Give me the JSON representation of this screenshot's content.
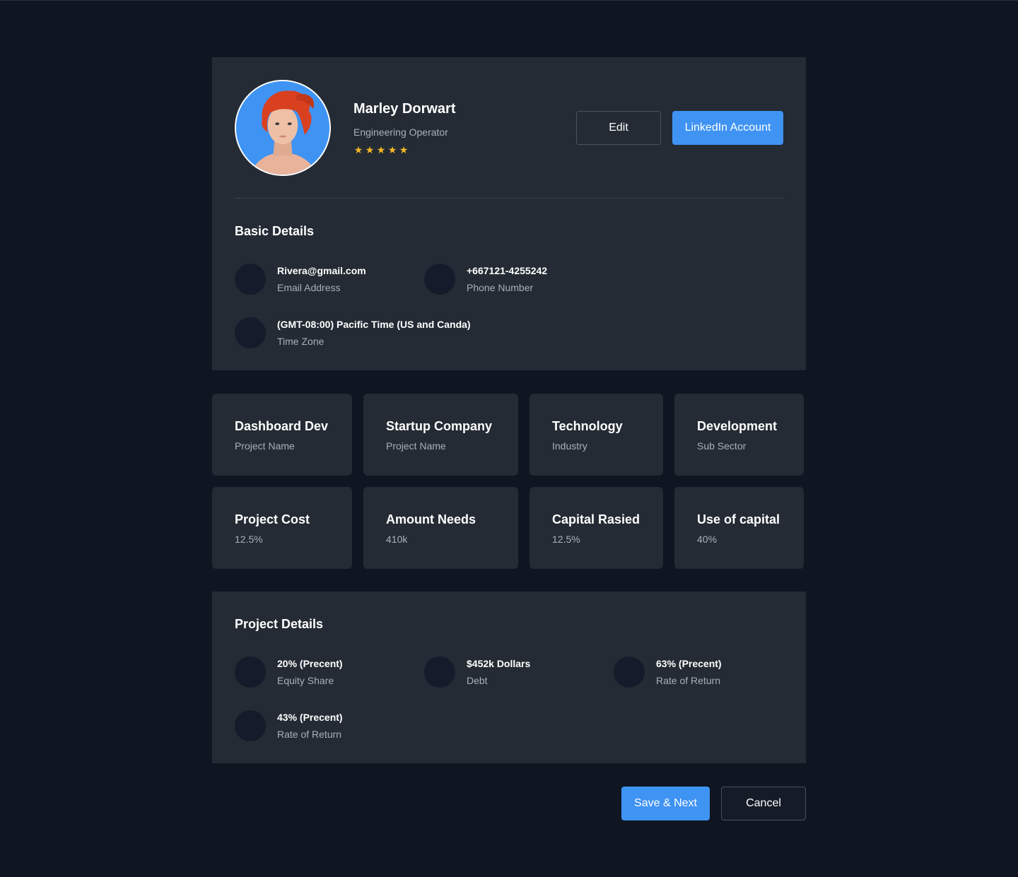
{
  "profile": {
    "name": "Marley Dorwart",
    "role": "Engineering Operator",
    "rating": 5,
    "edit_label": "Edit",
    "linkedin_label": "LinkedIn Account"
  },
  "basic_details": {
    "title": "Basic Details",
    "items": [
      {
        "value": "Rivera@gmail.com",
        "label": "Email Address"
      },
      {
        "value": "+667121-4255242",
        "label": "Phone Number"
      },
      {
        "value": "(GMT-08:00) Pacific Time (US and Canda)",
        "label": "Time Zone"
      }
    ]
  },
  "cards": [
    {
      "title": "Dashboard Dev",
      "sub": "Project Name"
    },
    {
      "title": "Startup Company",
      "sub": "Project Name"
    },
    {
      "title": "Technology",
      "sub": "Industry"
    },
    {
      "title": "Development",
      "sub": "Sub Sector"
    },
    {
      "title": "Project Cost",
      "sub": "12.5%"
    },
    {
      "title": "Amount Needs",
      "sub": "410k"
    },
    {
      "title": "Capital Rasied",
      "sub": "12.5%"
    },
    {
      "title": "Use of capital",
      "sub": "40%"
    }
  ],
  "project_details": {
    "title": "Project Details",
    "items": [
      {
        "value": "20% (Precent)",
        "label": "Equity Share"
      },
      {
        "value": "$452k Dollars",
        "label": "Debt"
      },
      {
        "value": "63% (Precent)",
        "label": "Rate of Return"
      },
      {
        "value": "43% (Precent)",
        "label": "Rate of Return"
      }
    ]
  },
  "footer": {
    "save_label": "Save & Next",
    "cancel_label": "Cancel"
  },
  "colors": {
    "background": "#0f1521",
    "panel": "#242b34",
    "accent": "#3f93f3",
    "star": "#f7b924",
    "icon_circle": "#141b2a"
  }
}
